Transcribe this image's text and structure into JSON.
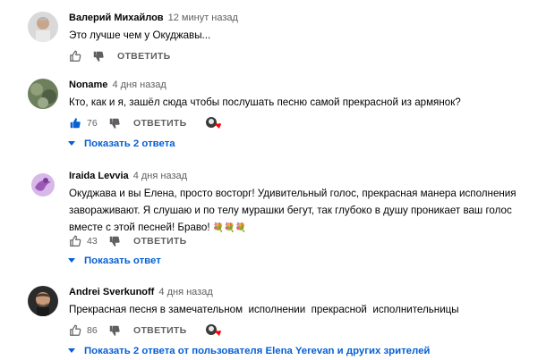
{
  "comments": [
    {
      "author": "Валерий Михайлов",
      "time": "12 минут назад",
      "text": "Это лучше чем у Окуджавы...",
      "likes": "",
      "reply_label": "ОТВЕТИТЬ"
    },
    {
      "author": "Noname",
      "time": "4 дня назад",
      "text": "Кто, как и я, зашёл сюда чтобы послушать песню самой прекрасной из армянок?",
      "likes": "76",
      "reply_label": "ОТВЕТИТЬ",
      "replies_label": "Показать 2 ответа"
    },
    {
      "author": "Iraida Levvia",
      "time": "4 дня назад",
      "text": "Окуджава и вы Елена, просто восторг! Удивительный голос, прекрасная манера исполнения завораживают. Я слушаю и по телу мурашки бегут, так глубоко в душу проникает ваш голос вместе с этой песней! Браво!",
      "flowers": "💐💐💐",
      "likes": "43",
      "reply_label": "ОТВЕТИТЬ",
      "replies_label": "Показать ответ"
    },
    {
      "author": "Andrei Sverkunoff",
      "time": "4 дня назад",
      "text": "Прекрасная песня в замечательном  исполнении  прекрасной  исполнительницы",
      "likes": "86",
      "reply_label": "ОТВЕТИТЬ",
      "replies_label": "Показать 2 ответа от пользователя Elena Yerevan и других зрителей"
    }
  ],
  "colors": {
    "link_blue": "#065fd4",
    "liked_blue": "#065fd4",
    "muted": "#606060",
    "heart_red": "#ff0000"
  }
}
